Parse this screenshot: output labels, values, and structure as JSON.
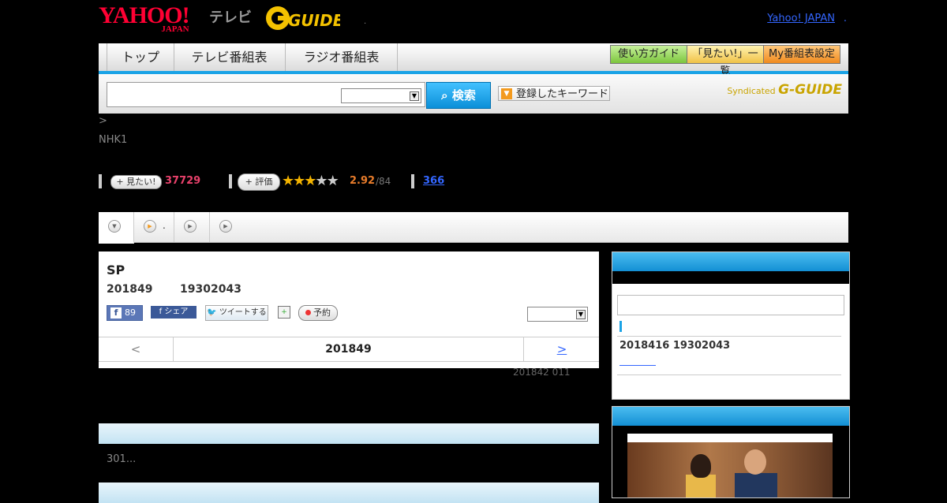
{
  "header": {
    "logo_yahoo": "YAHOO!",
    "logo_japan": "JAPAN",
    "logo_tv": "テレビ",
    "logo_gguide": "G-GUIDE",
    "logo_dot": ".",
    "yahoo_link": "Yahoo! JAPAN",
    "yahoo_link_suffix": "."
  },
  "nav": {
    "tabs": [
      "トップ",
      "テレビ番組表",
      "ラジオ番組表"
    ],
    "buttons": [
      "使い方ガイド",
      "「見たい!」一覧",
      "My番組表設定"
    ]
  },
  "search": {
    "button_label": "検索",
    "keyword_label": "登録したキーワード",
    "syndicated_label": "Syndicated",
    "syndicated_brand": "G-GUIDE"
  },
  "breadcrumb": ">",
  "channel": "NHK1",
  "stats": {
    "mitai_label": "見たい!",
    "mitai_count": "37729",
    "hyoka_label": "評価",
    "rating": 2.5,
    "score": "2.92",
    "score_of": "/84",
    "review_count": "366"
  },
  "subtabs": {
    "label_1": "."
  },
  "program": {
    "title": "SP",
    "date": "201849",
    "time": "19302043",
    "fb_like_count": "89",
    "fb_share_label": "シェア",
    "tweet_label": "ツイートする",
    "reserve_label": "予約",
    "nav_prev": "<",
    "nav_date": "201849",
    "nav_next": ">",
    "updated": "201842  011"
  },
  "description": "301...",
  "sidebar": {
    "date": "2018416  19302043"
  },
  "colors": {
    "accent_blue": "#1aa3e6",
    "count_pink": "#e8416b",
    "score_orange": "#e87c2b"
  }
}
